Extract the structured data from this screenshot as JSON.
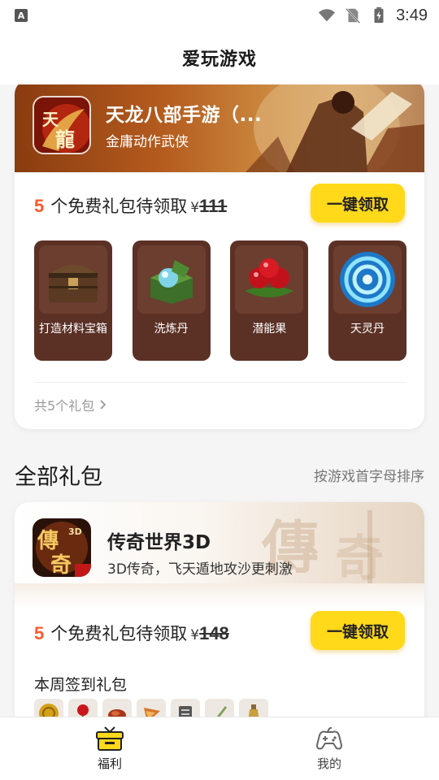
{
  "status_bar": {
    "app_icon_letter": "A",
    "time": "3:49"
  },
  "header": {
    "title": "爱玩游戏"
  },
  "featured_game": {
    "title": "天龙八部手游（...",
    "subtitle": "金庸动作武侠",
    "gift_count": "5",
    "gift_text": "个免费礼包待领取",
    "price_symbol": "¥",
    "price_value": "111",
    "claim_label": "一键领取",
    "items": [
      {
        "name": "打造材料宝箱",
        "icon": "treasure-chest-icon"
      },
      {
        "name": "洗炼丹",
        "icon": "gem-box-icon"
      },
      {
        "name": "潜能果",
        "icon": "red-fruit-icon"
      },
      {
        "name": "天灵丹",
        "icon": "blue-orb-icon"
      }
    ],
    "more_label": "共5个礼包"
  },
  "all_gifts": {
    "title": "全部礼包",
    "sort_label": "按游戏首字母排序"
  },
  "game2": {
    "title": "传奇世界3D",
    "subtitle": "3D传奇，飞天遁地攻沙更刺激",
    "gift_count": "5",
    "gift_text": "个免费礼包待领取",
    "price_symbol": "¥",
    "price_value": "148",
    "claim_label": "一键领取",
    "weekly_title": "本周签到礼包",
    "weekly_icons": [
      "gold-coin-icon",
      "rose-icon",
      "meat-icon",
      "flag-icon",
      "scroll-icon",
      "sword-icon",
      "bottle-icon"
    ]
  },
  "bottom_nav": {
    "welfare_label": "福利",
    "mine_label": "我的"
  },
  "colors": {
    "accent_yellow": "#ffd91a",
    "count_orange": "#ff5a2c",
    "item_bg": "#5b3126"
  }
}
